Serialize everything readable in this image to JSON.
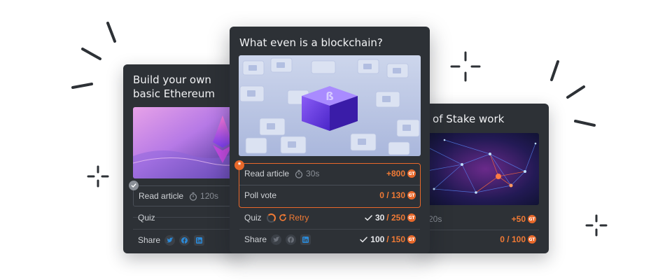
{
  "cards": {
    "left": {
      "title": "Build your own basic Ethereum",
      "read_label": "Read article",
      "read_time": "120s",
      "quiz_label": "Quiz",
      "share_label": "Share"
    },
    "center": {
      "title": "What even is a blockchain?",
      "read_label": "Read article",
      "read_time": "30s",
      "read_points": "+800",
      "poll_label": "Poll vote",
      "poll_points": "0 / 130",
      "quiz_label": "Quiz",
      "retry_label": "Retry",
      "quiz_score": "30",
      "quiz_total": "/ 250",
      "share_label": "Share",
      "share_score": "100",
      "share_total": "/ 150"
    },
    "right": {
      "title": "f of Stake work",
      "read_time": "20s",
      "read_points": "+50",
      "share_points": "0 / 100"
    }
  },
  "coin_symbol": "GT",
  "colors": {
    "card_bg": "#2d3136",
    "accent": "#e8682a",
    "points": "#f07a35",
    "social_blue": "#2b8ad8"
  },
  "icons": [
    "stopwatch-icon",
    "check-icon",
    "star-icon",
    "retry-icon",
    "twitter-icon",
    "facebook-icon",
    "linkedin-icon",
    "coin-icon"
  ]
}
